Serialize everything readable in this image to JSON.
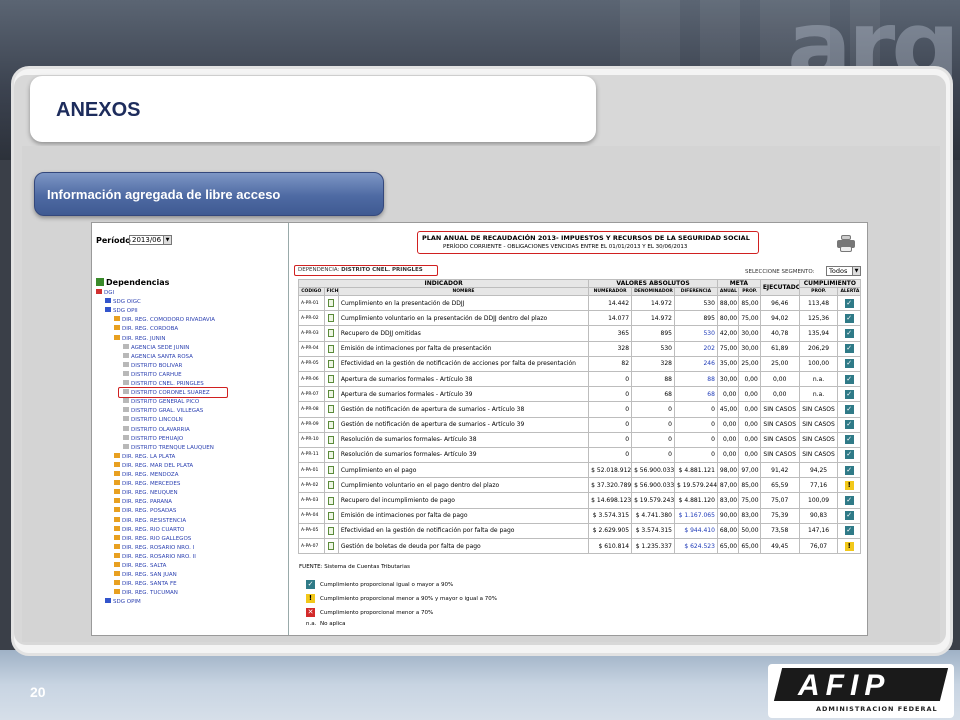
{
  "slide": {
    "title": "ANEXOS",
    "subtitle": "Información agregada de libre acceso",
    "page_number": "20",
    "watermark": "arg",
    "logo": {
      "mark": "AFIP",
      "subtitle": "ADMINISTRACION FEDERAL"
    }
  },
  "sidebar": {
    "periodo_label": "Período",
    "periodo_value": "2013/06",
    "dependencias_title": "Dependencias",
    "tree": [
      {
        "label": "DGI",
        "icon": "red",
        "level": 0
      },
      {
        "label": "SDG OIGC",
        "icon": "blue",
        "level": 1
      },
      {
        "label": "SDG OPII",
        "icon": "blue",
        "level": 1
      },
      {
        "label": "DIR. REG. COMODORO RIVADAVIA",
        "icon": "orange",
        "level": 2
      },
      {
        "label": "DIR. REG. CORDOBA",
        "icon": "orange",
        "level": 2
      },
      {
        "label": "DIR. REG. JUNIN",
        "icon": "orange",
        "level": 2
      },
      {
        "label": "AGENCIA SEDE JUNIN",
        "icon": "gray",
        "level": 3
      },
      {
        "label": "AGENCIA SANTA ROSA",
        "icon": "gray",
        "level": 3
      },
      {
        "label": "DISTRITO BOLIVAR",
        "icon": "gray",
        "level": 3
      },
      {
        "label": "DISTRITO CARHUE",
        "icon": "gray",
        "level": 3
      },
      {
        "label": "DISTRITO CNEL. PRINGLES",
        "icon": "gray",
        "level": 3
      },
      {
        "label": "DISTRITO CORONEL SUAREZ",
        "icon": "gray",
        "level": 3
      },
      {
        "label": "DISTRITO GENERAL PICO",
        "icon": "gray",
        "level": 3
      },
      {
        "label": "DISTRITO GRAL. VILLEGAS",
        "icon": "gray",
        "level": 3
      },
      {
        "label": "DISTRITO LINCOLN",
        "icon": "gray",
        "level": 3
      },
      {
        "label": "DISTRITO OLAVARRIA",
        "icon": "gray",
        "level": 3
      },
      {
        "label": "DISTRITO PEHUAJO",
        "icon": "gray",
        "level": 3
      },
      {
        "label": "DISTRITO TRENQUE LAUQUEN",
        "icon": "gray",
        "level": 3
      },
      {
        "label": "DIR. REG. LA PLATA",
        "icon": "orange",
        "level": 2
      },
      {
        "label": "DIR. REG. MAR DEL PLATA",
        "icon": "orange",
        "level": 2
      },
      {
        "label": "DIR. REG. MENDOZA",
        "icon": "orange",
        "level": 2
      },
      {
        "label": "DIR. REG. MERCEDES",
        "icon": "orange",
        "level": 2
      },
      {
        "label": "DIR. REG. NEUQUEN",
        "icon": "orange",
        "level": 2
      },
      {
        "label": "DIR. REG. PARANA",
        "icon": "orange",
        "level": 2
      },
      {
        "label": "DIR. REG. POSADAS",
        "icon": "orange",
        "level": 2
      },
      {
        "label": "DIR. REG. RESISTENCIA",
        "icon": "orange",
        "level": 2
      },
      {
        "label": "DIR. REG. RIO CUARTO",
        "icon": "orange",
        "level": 2
      },
      {
        "label": "DIR. REG. RIO GALLEGOS",
        "icon": "orange",
        "level": 2
      },
      {
        "label": "DIR. REG. ROSARIO NRO. I",
        "icon": "orange",
        "level": 2
      },
      {
        "label": "DIR. REG. ROSARIO NRO. II",
        "icon": "orange",
        "level": 2
      },
      {
        "label": "DIR. REG. SALTA",
        "icon": "orange",
        "level": 2
      },
      {
        "label": "DIR. REG. SAN JUAN",
        "icon": "orange",
        "level": 2
      },
      {
        "label": "DIR. REG. SANTA FE",
        "icon": "orange",
        "level": 2
      },
      {
        "label": "DIR. REG. TUCUMAN",
        "icon": "orange",
        "level": 2
      },
      {
        "label": "SDG OPIM",
        "icon": "blue",
        "level": 1
      }
    ],
    "highlighted_index": 11
  },
  "report": {
    "header_line1": "PLAN ANUAL DE RECAUDACIÓN 2013- IMPUESTOS Y RECURSOS DE LA SEGURIDAD SOCIAL",
    "header_line2": "PERÍODO CORRIENTE - OBLIGACIONES VENCIDAS ENTRE EL 01/01/2013 Y EL 30/06/2013",
    "dependencia_label": "DEPENDENCIA:",
    "dependencia_value": "DISTRITO CNEL. PRINGLES",
    "segmento_label": "SELECCIONE SEGMENTO:",
    "segmento_value": "Todos",
    "group_headers": {
      "indicador": "INDICADOR",
      "valores": "VALORES ABSOLUTOS",
      "meta": "META",
      "ejecutado": "EJECUTADO",
      "cumplimiento": "CUMPLIMIENTO"
    },
    "sub_headers": {
      "codigo": "CÓDIGO",
      "ficha": "FICHA",
      "nombre": "NOMBRE",
      "numerador": "NUMERADOR",
      "denominador": "DENOMINADOR",
      "diferencia": "DIFERENCIA",
      "anual": "ANUAL",
      "prop": "PROP.",
      "cprop": "PROP.",
      "alerta": "ALERTA"
    },
    "rows": [
      {
        "code": "A-PR-01",
        "name": "Cumplimiento en la presentación de DDJJ",
        "num": "14.442",
        "den": "14.972",
        "dif": "530",
        "dif_blue": false,
        "anual": "88,00",
        "prop": "85,00",
        "ejec": "96,46",
        "cprop": "113,48",
        "alert": "ok"
      },
      {
        "code": "A-PR-02",
        "name": "Cumplimiento voluntario en la presentación de DDJJ dentro del plazo",
        "num": "14.077",
        "den": "14.972",
        "dif": "895",
        "dif_blue": false,
        "anual": "80,00",
        "prop": "75,00",
        "ejec": "94,02",
        "cprop": "125,36",
        "alert": "ok"
      },
      {
        "code": "A-PR-03",
        "name": "Recupero de DDJJ omitidas",
        "num": "365",
        "den": "895",
        "dif": "530",
        "dif_blue": true,
        "anual": "42,00",
        "prop": "30,00",
        "ejec": "40,78",
        "cprop": "135,94",
        "alert": "ok"
      },
      {
        "code": "A-PR-04",
        "name": "Emisión de intimaciones por falta de presentación",
        "num": "328",
        "den": "530",
        "dif": "202",
        "dif_blue": true,
        "anual": "75,00",
        "prop": "30,00",
        "ejec": "61,89",
        "cprop": "206,29",
        "alert": "ok"
      },
      {
        "code": "A-PR-05",
        "name": "Efectividad en la gestión de notificación de acciones por falta de presentación",
        "num": "82",
        "den": "328",
        "dif": "246",
        "dif_blue": true,
        "anual": "35,00",
        "prop": "25,00",
        "ejec": "25,00",
        "cprop": "100,00",
        "alert": "ok"
      },
      {
        "code": "A-PR-06",
        "name": "Apertura de sumarios formales - Artículo 38",
        "num": "0",
        "den": "88",
        "dif": "88",
        "dif_blue": true,
        "anual": "30,00",
        "prop": "0,00",
        "ejec": "0,00",
        "cprop": "n.a.",
        "alert": "ok"
      },
      {
        "code": "A-PR-07",
        "name": "Apertura de sumarios formales - Artículo 39",
        "num": "0",
        "den": "68",
        "dif": "68",
        "dif_blue": true,
        "anual": "0,00",
        "prop": "0,00",
        "ejec": "0,00",
        "cprop": "n.a.",
        "alert": "ok"
      },
      {
        "code": "A-PR-08",
        "name": "Gestión de notificación de apertura de sumarios - Artículo 38",
        "num": "0",
        "den": "0",
        "dif": "0",
        "dif_blue": false,
        "anual": "45,00",
        "prop": "0,00",
        "ejec": "SIN CASOS",
        "cprop": "SIN CASOS",
        "alert": "ok"
      },
      {
        "code": "A-PR-09",
        "name": "Gestión de notificación de apertura de sumarios - Artículo 39",
        "num": "0",
        "den": "0",
        "dif": "0",
        "dif_blue": false,
        "anual": "0,00",
        "prop": "0,00",
        "ejec": "SIN CASOS",
        "cprop": "SIN CASOS",
        "alert": "ok"
      },
      {
        "code": "A-PR-10",
        "name": "Resolución de sumarios formales- Artículo 38",
        "num": "0",
        "den": "0",
        "dif": "0",
        "dif_blue": false,
        "anual": "0,00",
        "prop": "0,00",
        "ejec": "SIN CASOS",
        "cprop": "SIN CASOS",
        "alert": "ok"
      },
      {
        "code": "A-PR-11",
        "name": "Resolución de sumarios formales- Artículo 39",
        "num": "0",
        "den": "0",
        "dif": "0",
        "dif_blue": false,
        "anual": "0,00",
        "prop": "0,00",
        "ejec": "SIN CASOS",
        "cprop": "SIN CASOS",
        "alert": "ok"
      },
      {
        "code": "A-PA-01",
        "name": "Cumplimiento en el pago",
        "num": "$ 52.018.912",
        "den": "$ 56.900.033",
        "dif": "$ 4.881.121",
        "dif_blue": false,
        "anual": "98,00",
        "prop": "97,00",
        "ejec": "91,42",
        "cprop": "94,25",
        "alert": "ok"
      },
      {
        "code": "A-PA-02",
        "name": "Cumplimiento voluntario en el pago dentro del plazo",
        "num": "$ 37.320.789",
        "den": "$ 56.900.033",
        "dif": "$ 19.579.244",
        "dif_blue": false,
        "anual": "87,00",
        "prop": "85,00",
        "ejec": "65,59",
        "cprop": "77,16",
        "alert": "warn"
      },
      {
        "code": "A-PA-03",
        "name": "Recupero del incumplimiento de pago",
        "num": "$ 14.698.123",
        "den": "$ 19.579.243",
        "dif": "$ 4.881.120",
        "dif_blue": false,
        "anual": "83,00",
        "prop": "75,00",
        "ejec": "75,07",
        "cprop": "100,09",
        "alert": "ok"
      },
      {
        "code": "A-PA-04",
        "name": "Emisión de intimaciones por falta de pago",
        "num": "$ 3.574.315",
        "den": "$ 4.741.380",
        "dif": "$ 1.167.065",
        "dif_blue": true,
        "anual": "90,00",
        "prop": "83,00",
        "ejec": "75,39",
        "cprop": "90,83",
        "alert": "ok"
      },
      {
        "code": "A-PA-05",
        "name": "Efectividad en la gestión de notificación por falta de pago",
        "num": "$ 2.629.905",
        "den": "$ 3.574.315",
        "dif": "$ 944.410",
        "dif_blue": true,
        "anual": "68,00",
        "prop": "50,00",
        "ejec": "73,58",
        "cprop": "147,16",
        "alert": "ok"
      },
      {
        "code": "A-PA-07",
        "name": "Gestión de boletas de deuda por falta de pago",
        "num": "$ 610.814",
        "den": "$ 1.235.337",
        "dif": "$ 624.523",
        "dif_blue": true,
        "anual": "65,00",
        "prop": "65,00",
        "ejec": "49,45",
        "cprop": "76,07",
        "alert": "warn"
      }
    ],
    "fuente": "FUENTE: Sistema de Cuentas Tributarias",
    "legend": [
      {
        "icon": "check",
        "text": "Cumplimiento proporcional igual o mayor a 90%"
      },
      {
        "icon": "warn",
        "text": "Cumplimiento proporcional menor a 90% y mayor o igual a 70%"
      },
      {
        "icon": "x",
        "text": "Cumplimiento proporcional menor a 70%"
      },
      {
        "icon": "na",
        "text": "No aplica",
        "prefix": "n.a."
      }
    ]
  }
}
